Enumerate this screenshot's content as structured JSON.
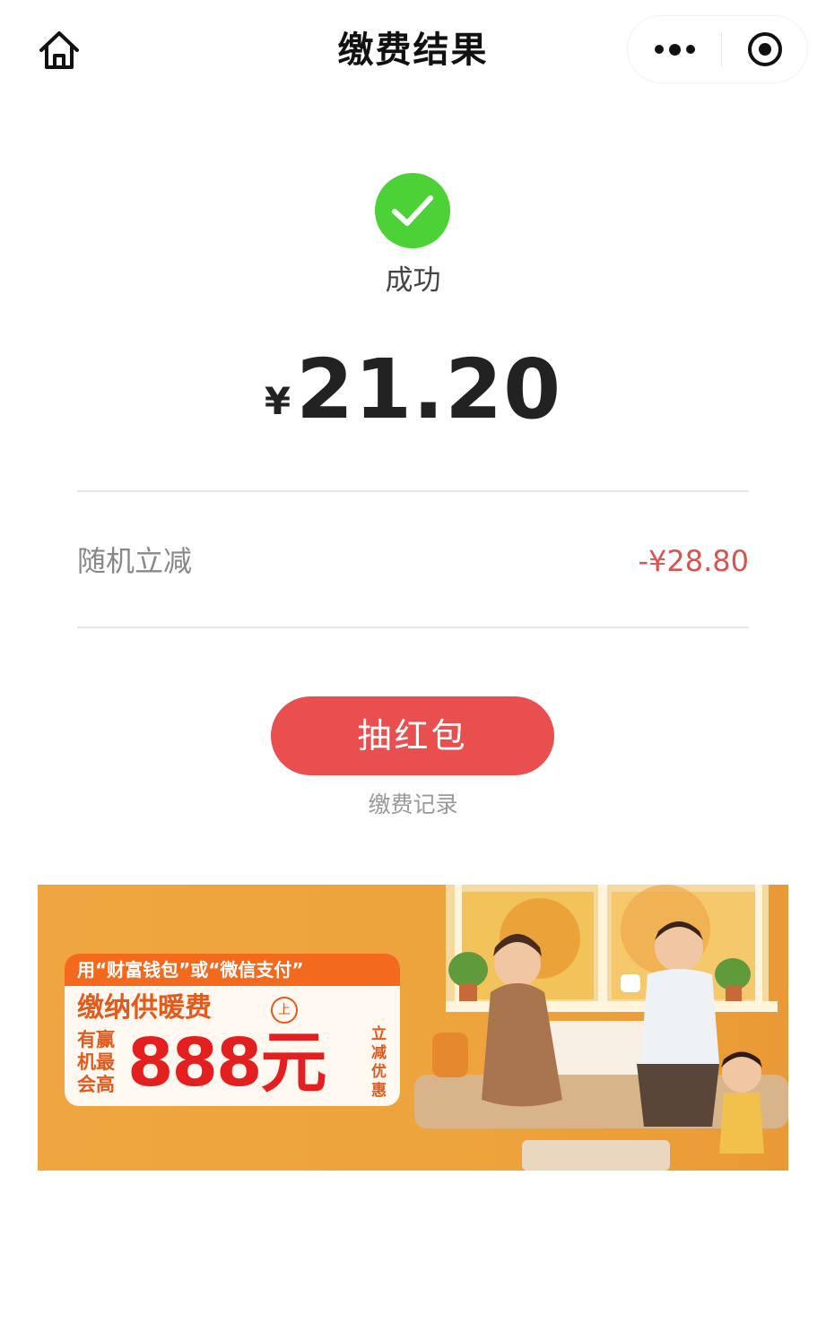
{
  "navbar": {
    "title": "缴费结果",
    "home_icon": "home-icon",
    "more_icon": "more-dots-icon",
    "close_icon": "target-circle-icon"
  },
  "result": {
    "status": "成功",
    "status_color": "#4cd137",
    "currency": "¥",
    "amount": "21.20"
  },
  "discount": {
    "label": "随机立减",
    "value": "-¥28.80",
    "value_color": "#d9534f"
  },
  "actions": {
    "red_packet_label": "抽红包",
    "red_packet_color": "#e94f4f",
    "record_link": "缴费记录"
  },
  "banner": {
    "top_line": "用“财富钱包”或“微信支付”",
    "title": "缴纳供暖费",
    "side_left": "有赢机最会高",
    "big_text": "888元",
    "side_right": "立减优惠",
    "seal_text": "上"
  }
}
